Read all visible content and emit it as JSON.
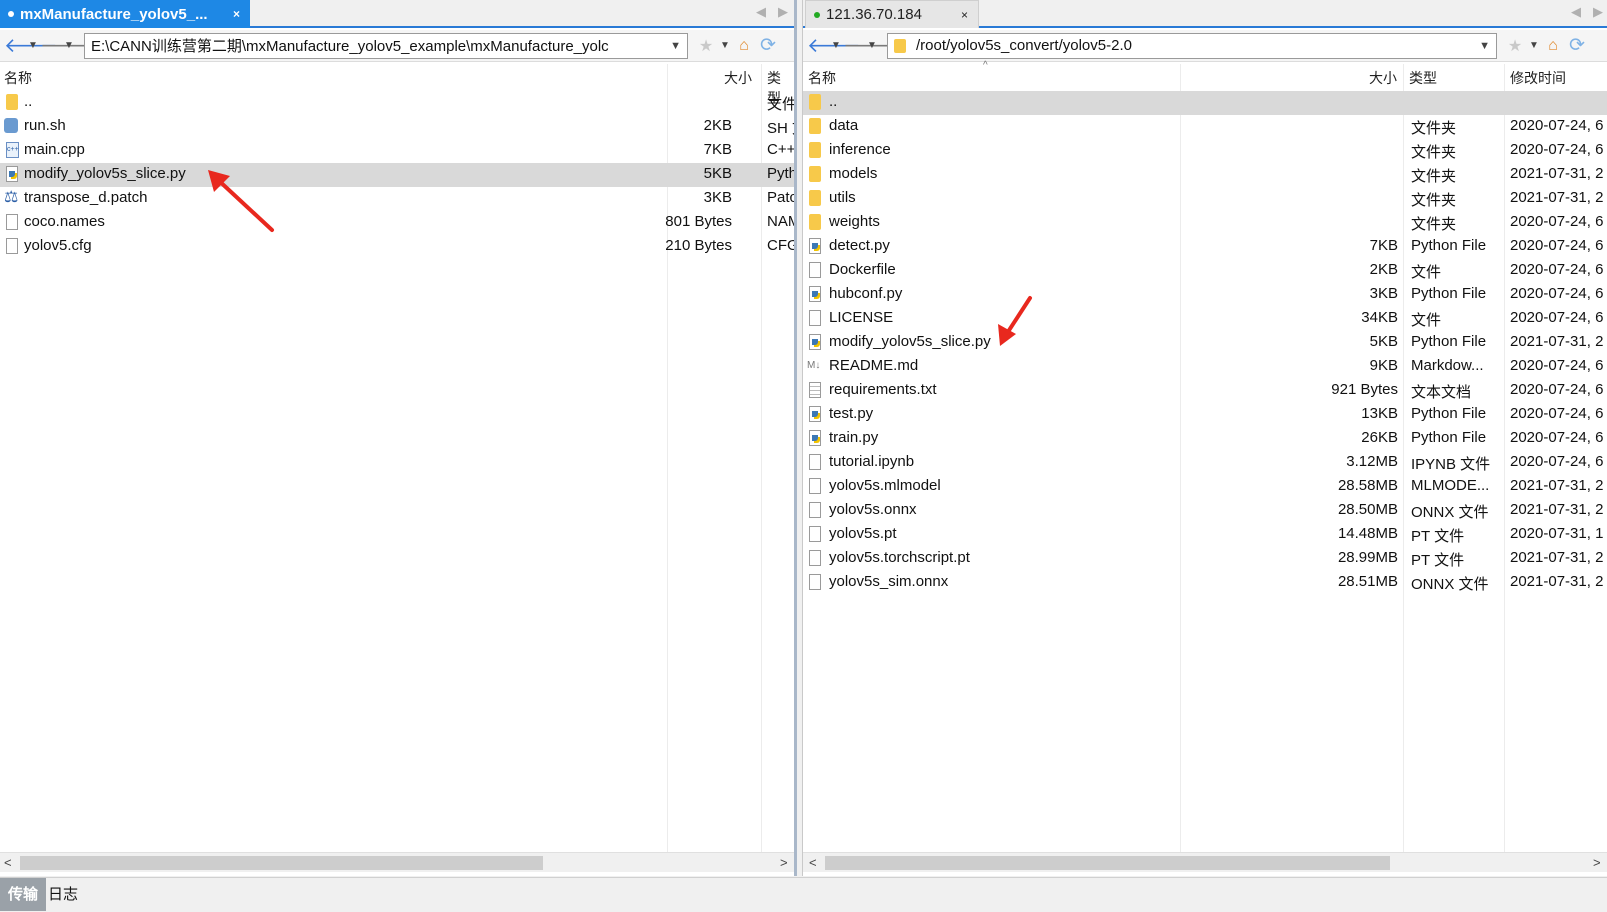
{
  "left": {
    "tab_title": "mxManufacture_yolov5_...",
    "tab_close": "×",
    "path": "E:\\CANN训练营第二期\\mxManufacture_yolov5_example\\mxManufacture_yolc",
    "headers": {
      "name": "名称",
      "size": "大小",
      "type": "类型"
    },
    "files": [
      {
        "name": "..",
        "size": "",
        "type": "文件",
        "icon": "folder-icon"
      },
      {
        "name": "run.sh",
        "size": "2KB",
        "type": "SH 文",
        "icon": "shell-icon"
      },
      {
        "name": "main.cpp",
        "size": "7KB",
        "type": "C++",
        "icon": "cpp-file-icon"
      },
      {
        "name": "modify_yolov5s_slice.py",
        "size": "5KB",
        "type": "Pyth",
        "icon": "python-file-icon",
        "selected": true
      },
      {
        "name": "transpose_d.patch",
        "size": "3KB",
        "type": "Patc",
        "icon": "patch-file-icon"
      },
      {
        "name": "coco.names",
        "size": "801 Bytes",
        "type": "NAM",
        "icon": "file-icon"
      },
      {
        "name": "yolov5.cfg",
        "size": "210 Bytes",
        "type": "CFG",
        "icon": "file-icon"
      }
    ]
  },
  "right": {
    "tab_title": "121.36.70.184",
    "tab_close": "×",
    "path": "/root/yolov5s_convert/yolov5-2.0",
    "headers": {
      "name": "名称",
      "size": "大小",
      "type": "类型",
      "modified": "修改时间"
    },
    "files": [
      {
        "name": "..",
        "size": "",
        "type": "",
        "modified": "",
        "icon": "folder-icon",
        "selected": true
      },
      {
        "name": "data",
        "size": "",
        "type": "文件夹",
        "modified": "2020-07-24, 6",
        "icon": "folder-icon"
      },
      {
        "name": "inference",
        "size": "",
        "type": "文件夹",
        "modified": "2020-07-24, 6",
        "icon": "folder-icon"
      },
      {
        "name": "models",
        "size": "",
        "type": "文件夹",
        "modified": "2021-07-31, 2",
        "icon": "folder-icon"
      },
      {
        "name": "utils",
        "size": "",
        "type": "文件夹",
        "modified": "2021-07-31, 2",
        "icon": "folder-icon"
      },
      {
        "name": "weights",
        "size": "",
        "type": "文件夹",
        "modified": "2020-07-24, 6",
        "icon": "folder-icon"
      },
      {
        "name": "detect.py",
        "size": "7KB",
        "type": "Python File",
        "modified": "2020-07-24, 6",
        "icon": "python-file-icon"
      },
      {
        "name": "Dockerfile",
        "size": "2KB",
        "type": "文件",
        "modified": "2020-07-24, 6",
        "icon": "file-icon"
      },
      {
        "name": "hubconf.py",
        "size": "3KB",
        "type": "Python File",
        "modified": "2020-07-24, 6",
        "icon": "python-file-icon"
      },
      {
        "name": "LICENSE",
        "size": "34KB",
        "type": "文件",
        "modified": "2020-07-24, 6",
        "icon": "file-icon"
      },
      {
        "name": "modify_yolov5s_slice.py",
        "size": "5KB",
        "type": "Python File",
        "modified": "2021-07-31, 2",
        "icon": "python-file-icon"
      },
      {
        "name": "README.md",
        "size": "9KB",
        "type": "Markdow...",
        "modified": "2020-07-24, 6",
        "icon": "markdown-file-icon"
      },
      {
        "name": "requirements.txt",
        "size": "921 Bytes",
        "type": "文本文档",
        "modified": "2020-07-24, 6",
        "icon": "text-file-icon"
      },
      {
        "name": "test.py",
        "size": "13KB",
        "type": "Python File",
        "modified": "2020-07-24, 6",
        "icon": "python-file-icon"
      },
      {
        "name": "train.py",
        "size": "26KB",
        "type": "Python File",
        "modified": "2020-07-24, 6",
        "icon": "python-file-icon"
      },
      {
        "name": "tutorial.ipynb",
        "size": "3.12MB",
        "type": "IPYNB 文件",
        "modified": "2020-07-24, 6",
        "icon": "file-icon"
      },
      {
        "name": "yolov5s.mlmodel",
        "size": "28.58MB",
        "type": "MLMODE...",
        "modified": "2021-07-31, 2",
        "icon": "file-icon"
      },
      {
        "name": "yolov5s.onnx",
        "size": "28.50MB",
        "type": "ONNX 文件",
        "modified": "2021-07-31, 2",
        "icon": "file-icon"
      },
      {
        "name": "yolov5s.pt",
        "size": "14.48MB",
        "type": "PT 文件",
        "modified": "2020-07-31, 1",
        "icon": "file-icon"
      },
      {
        "name": "yolov5s.torchscript.pt",
        "size": "28.99MB",
        "type": "PT 文件",
        "modified": "2021-07-31, 2",
        "icon": "file-icon"
      },
      {
        "name": "yolov5s_sim.onnx",
        "size": "28.51MB",
        "type": "ONNX 文件",
        "modified": "2021-07-31, 2",
        "icon": "file-icon"
      }
    ]
  },
  "bottom_tabs": [
    "传输",
    "日志"
  ],
  "colors": {
    "accent": "#1e88e5",
    "arrow": "#e8281e",
    "selection": "#d9d9d9"
  }
}
